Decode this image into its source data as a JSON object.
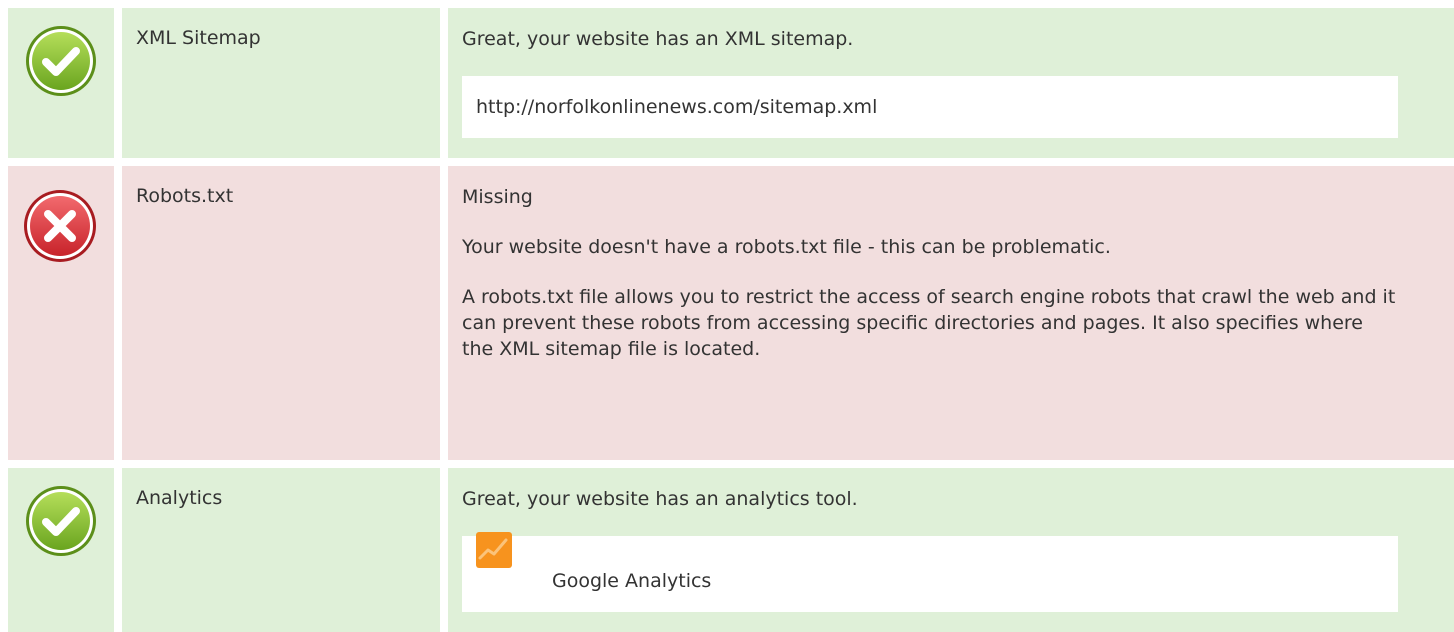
{
  "rows": [
    {
      "status": "pass",
      "label": "XML Sitemap",
      "message": "Great, your website has an XML sitemap.",
      "box_text": "http://norfolkonlinenews.com/sitemap.xml",
      "icon": "check-circle-icon"
    },
    {
      "status": "fail",
      "label": "Robots.txt",
      "message": "Missing",
      "paragraphs": [
        "Your website doesn't have a robots.txt file - this can be problematic.",
        "A robots.txt file allows you to restrict the access of search engine robots that crawl the web and it can prevent these robots from accessing specific directories and pages. It also specifies where the XML sitemap file is located."
      ],
      "icon": "cross-circle-icon"
    },
    {
      "status": "pass",
      "label": "Analytics",
      "message": "Great, your website has an analytics tool.",
      "tool_name": "Google Analytics",
      "tool_icon": "google-analytics-icon",
      "icon": "check-circle-icon"
    }
  ],
  "colors": {
    "pass_bg": "#dff0d8",
    "fail_bg": "#f2dede",
    "check_green": "#8cc63f",
    "cross_red": "#e0393e",
    "analytics_orange": "#f7931e"
  }
}
